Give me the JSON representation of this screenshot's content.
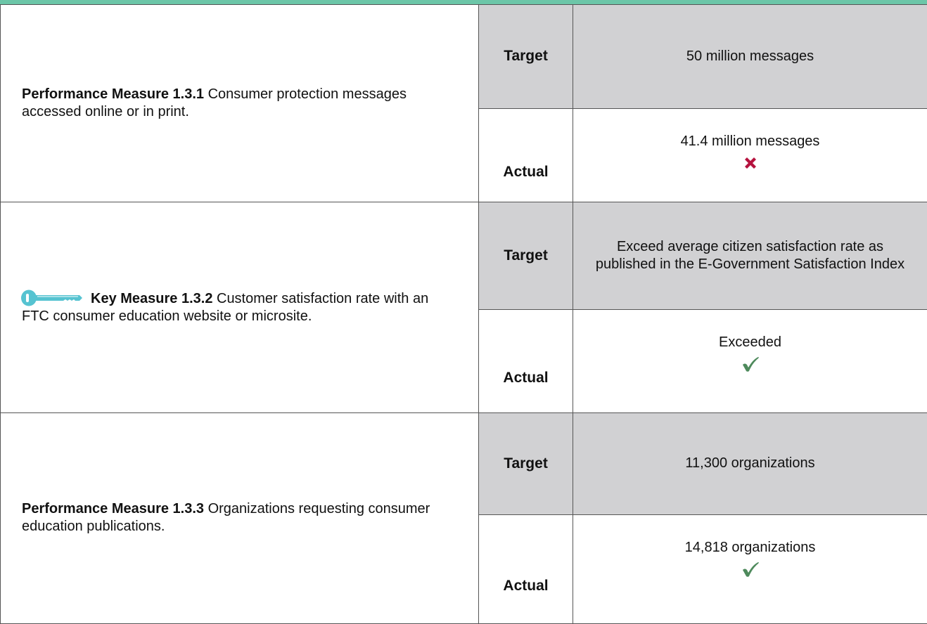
{
  "colors": {
    "accent_bar": "#6cc6a8",
    "target_bg": "#d1d1d3",
    "grid": "#555555",
    "key_icon": "#56c3d1",
    "fail_icon": "#b5123e",
    "pass_icon": "#4e8a5c"
  },
  "rows": [
    {
      "measure_title": "Performance Measure 1.3.1",
      "measure_text": " Consumer protection messages accessed online or in print.",
      "target_label": "Target",
      "target_value": "50 million messages",
      "actual_label": "Actual",
      "actual_value": "41.4 million messages",
      "status_icon": "x-mark-icon"
    },
    {
      "icon": "key-icon",
      "measure_title": "Key Measure 1.3.2",
      "measure_text": " Customer satisfaction rate with an FTC consumer education website or microsite.",
      "target_label": "Target",
      "target_value": "Exceed average citizen satisfaction rate as published in the  E-Government Satisfaction Index",
      "actual_label": "Actual",
      "actual_value": "Exceeded",
      "status_icon": "check-mark-icon"
    },
    {
      "measure_title": "Performance Measure 1.3.3",
      "measure_text": " Organizations requesting consumer education publications.",
      "target_label": "Target",
      "target_value": "11,300  organizations",
      "actual_label": "Actual",
      "actual_value": "14,818  organizations",
      "status_icon": "check-mark-icon"
    }
  ]
}
